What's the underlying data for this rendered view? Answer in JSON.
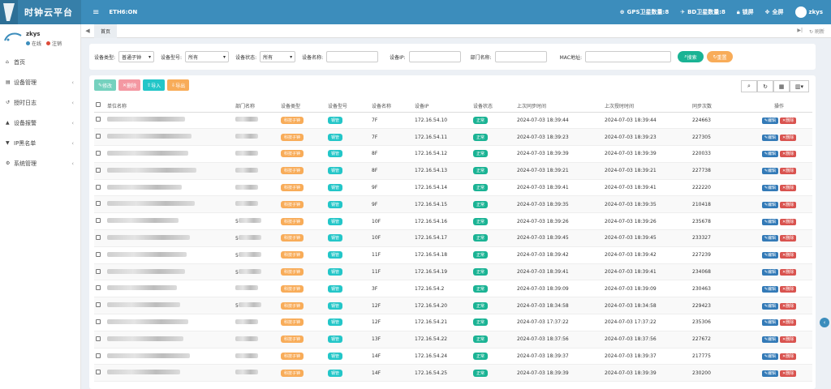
{
  "app": {
    "title": "时钟云平台",
    "menu_icon": "≡",
    "eth_status": "ETH6:ON",
    "gps_label": "GPS卫星数量:8",
    "bd_label": "BD卫星数量:8",
    "lock_label": "锁屏",
    "fullscreen_label": "全屏",
    "user": "zkys"
  },
  "sidebar": {
    "user_name": "zkys",
    "online_label": "在线",
    "logout_label": "注销",
    "items": [
      {
        "icon": "home-icon",
        "glyph": "⌂",
        "label": "首页",
        "has_arrow": false
      },
      {
        "icon": "list-icon",
        "glyph": "▤",
        "label": "设备管理",
        "has_arrow": true
      },
      {
        "icon": "history-icon",
        "glyph": "↺",
        "label": "授时日志",
        "has_arrow": true
      },
      {
        "icon": "warning-icon",
        "glyph": "▲",
        "label": "设备报警",
        "has_arrow": true
      },
      {
        "icon": "filter-icon",
        "glyph": "▼",
        "label": "IP黑名单",
        "has_arrow": true
      },
      {
        "icon": "gear-icon",
        "glyph": "⚙",
        "label": "系统管理",
        "has_arrow": true
      }
    ]
  },
  "tabs": {
    "home": "首页",
    "refresh_label": "刷新"
  },
  "filters": {
    "device_type_label": "设备类型:",
    "device_type_value": "普通子钟",
    "device_model_label": "设备型号:",
    "device_model_value": "所有",
    "device_status_label": "设备状态:",
    "device_status_value": "所有",
    "device_name_label": "设备名称:",
    "device_ip_label": "设备IP:",
    "dept_label": "部门名称:",
    "mac_label": "MAC地址:",
    "search_label": "搜索",
    "reset_label": "重置"
  },
  "toolbar": {
    "edit_label": "修改",
    "delete_label": "删除",
    "import_label": "导入",
    "export_label": "导出"
  },
  "table": {
    "headers": [
      "单位名称",
      "部门名称",
      "设备类型",
      "设备型号",
      "设备名称",
      "设备IP",
      "设备状态",
      "上次同步时间",
      "上次授时时间",
      "同步次数",
      "操作"
    ],
    "edit_label": "编辑",
    "delete_label": "删除",
    "rows": [
      {
        "dept_prefix": "",
        "type": "科技子钟",
        "model": "钢管",
        "name": "7F",
        "ip": "172.16.54.10",
        "status": "正常",
        "sync": "2024-07-03 18:39:44",
        "timing": "2024-07-03 18:39:44",
        "count": "224663"
      },
      {
        "dept_prefix": "",
        "type": "科技子钟",
        "model": "钢管",
        "name": "7F",
        "ip": "172.16.54.11",
        "status": "正常",
        "sync": "2024-07-03 18:39:23",
        "timing": "2024-07-03 18:39:23",
        "count": "227305"
      },
      {
        "dept_prefix": "",
        "type": "科技子钟",
        "model": "钢管",
        "name": "8F",
        "ip": "172.16.54.12",
        "status": "正常",
        "sync": "2024-07-03 18:39:39",
        "timing": "2024-07-03 18:39:39",
        "count": "220033"
      },
      {
        "dept_prefix": "",
        "type": "科技子钟",
        "model": "钢管",
        "name": "8F",
        "ip": "172.16.54.13",
        "status": "正常",
        "sync": "2024-07-03 18:39:21",
        "timing": "2024-07-03 18:39:21",
        "count": "227738"
      },
      {
        "dept_prefix": "",
        "type": "科技子钟",
        "model": "钢管",
        "name": "9F",
        "ip": "172.16.54.14",
        "status": "正常",
        "sync": "2024-07-03 18:39:41",
        "timing": "2024-07-03 18:39:41",
        "count": "222220"
      },
      {
        "dept_prefix": "",
        "type": "科技子钟",
        "model": "钢管",
        "name": "9F",
        "ip": "172.16.54.15",
        "status": "正常",
        "sync": "2024-07-03 18:39:35",
        "timing": "2024-07-03 18:39:35",
        "count": "210418"
      },
      {
        "dept_prefix": "5",
        "type": "科技子钟",
        "model": "钢管",
        "name": "10F",
        "ip": "172.16.54.16",
        "status": "正常",
        "sync": "2024-07-03 18:39:26",
        "timing": "2024-07-03 18:39:26",
        "count": "235678"
      },
      {
        "dept_prefix": "5",
        "type": "科技子钟",
        "model": "钢管",
        "name": "10F",
        "ip": "172.16.54.17",
        "status": "正常",
        "sync": "2024-07-03 18:39:45",
        "timing": "2024-07-03 18:39:45",
        "count": "233327"
      },
      {
        "dept_prefix": "5",
        "type": "科技子钟",
        "model": "钢管",
        "name": "11F",
        "ip": "172.16.54.18",
        "status": "正常",
        "sync": "2024-07-03 18:39:42",
        "timing": "2024-07-03 18:39:42",
        "count": "227239"
      },
      {
        "dept_prefix": "5",
        "type": "科技子钟",
        "model": "钢管",
        "name": "11F",
        "ip": "172.16.54.19",
        "status": "正常",
        "sync": "2024-07-03 18:39:41",
        "timing": "2024-07-03 18:39:41",
        "count": "234068"
      },
      {
        "dept_prefix": "",
        "type": "科技子钟",
        "model": "钢管",
        "name": "3F",
        "ip": "172.16.54.2",
        "status": "正常",
        "sync": "2024-07-03 18:39:09",
        "timing": "2024-07-03 18:39:09",
        "count": "230463"
      },
      {
        "dept_prefix": "5",
        "type": "科技子钟",
        "model": "钢管",
        "name": "12F",
        "ip": "172.16.54.20",
        "status": "正常",
        "sync": "2024-07-03 18:34:58",
        "timing": "2024-07-03 18:34:58",
        "count": "229423"
      },
      {
        "dept_prefix": "",
        "type": "科技子钟",
        "model": "钢管",
        "name": "12F",
        "ip": "172.16.54.21",
        "status": "正常",
        "sync": "2024-07-03 17:37:22",
        "timing": "2024-07-03 17:37:22",
        "count": "235306"
      },
      {
        "dept_prefix": "",
        "type": "科技子钟",
        "model": "钢管",
        "name": "13F",
        "ip": "172.16.54.22",
        "status": "正常",
        "sync": "2024-07-03 18:37:56",
        "timing": "2024-07-03 18:37:56",
        "count": "227672"
      },
      {
        "dept_prefix": "",
        "type": "科技子钟",
        "model": "钢管",
        "name": "14F",
        "ip": "172.16.54.24",
        "status": "正常",
        "sync": "2024-07-03 18:39:37",
        "timing": "2024-07-03 18:39:37",
        "count": "217775"
      },
      {
        "dept_prefix": "",
        "type": "科技子钟",
        "model": "钢管",
        "name": "14F",
        "ip": "172.16.54.25",
        "status": "正常",
        "sync": "2024-07-03 18:39:39",
        "timing": "2024-07-03 18:39:39",
        "count": "230200"
      }
    ]
  },
  "colors": {
    "header": "#3c8dbc",
    "header_dark": "#367fa9",
    "search": "#1ab394",
    "reset": "#f8ac59",
    "edit_toolbar": "#1ab394",
    "delete_toolbar": "#ed5565",
    "import_toolbar": "#23c6c8",
    "export_toolbar": "#f8ac59"
  }
}
